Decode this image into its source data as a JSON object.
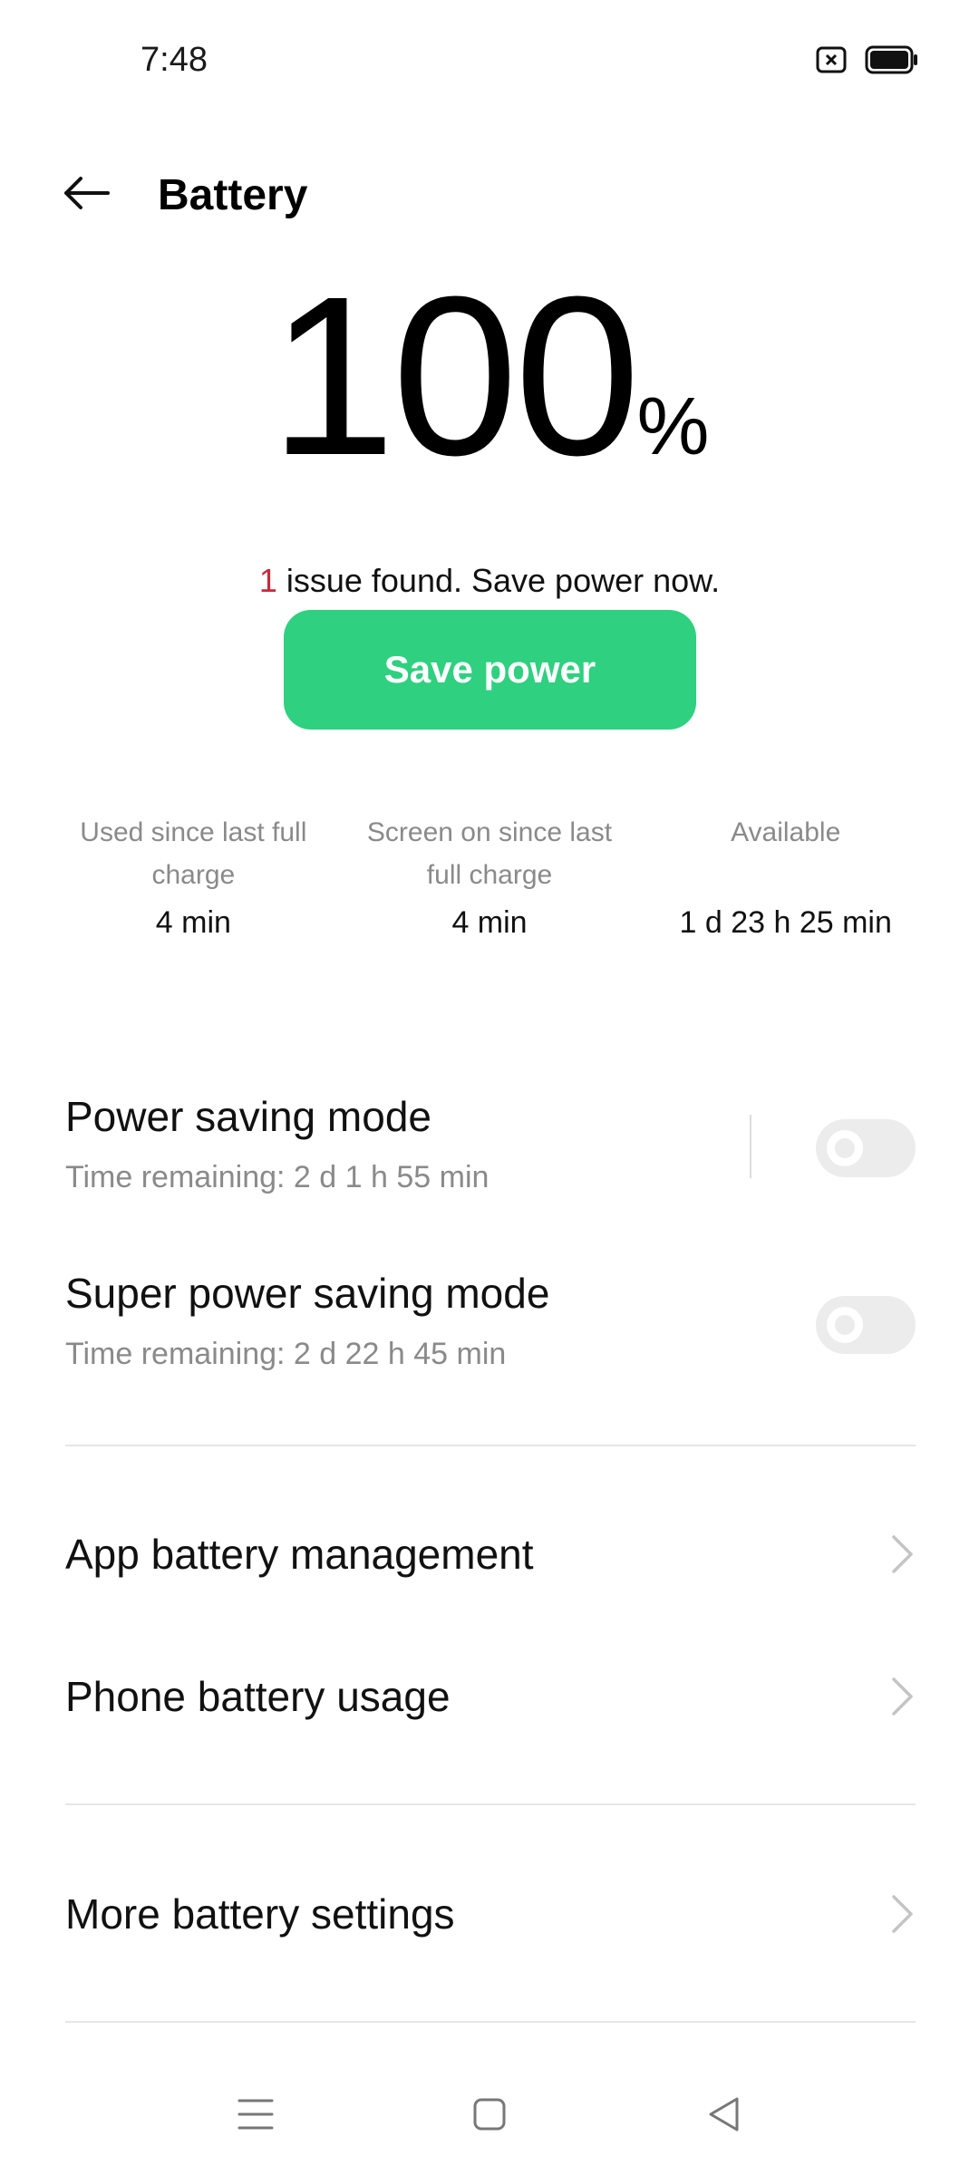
{
  "status_bar": {
    "time": "7:48"
  },
  "header": {
    "title": "Battery"
  },
  "battery": {
    "percent": "100",
    "percent_sign": "%",
    "issue_count": "1",
    "issue_text": " issue found. Save power now."
  },
  "save_button": {
    "label": "Save power"
  },
  "stats": [
    {
      "label": "Used since last full charge",
      "value": "4 min"
    },
    {
      "label": "Screen on since last full charge",
      "value": "4 min"
    },
    {
      "label": "Available",
      "value": "1 d 23 h 25 min"
    }
  ],
  "power_saving": {
    "title": "Power saving mode",
    "subtitle": "Time remaining:  2 d 1 h 55 min",
    "enabled": false
  },
  "super_power_saving": {
    "title": "Super power saving mode",
    "subtitle": "Time remaining:  2 d 22 h 45 min",
    "enabled": false
  },
  "menu": {
    "app_battery": "App battery management",
    "phone_battery": "Phone battery usage",
    "more_settings": "More battery settings"
  },
  "colors": {
    "accent": "#2fd07f",
    "issue": "#c8283c"
  }
}
